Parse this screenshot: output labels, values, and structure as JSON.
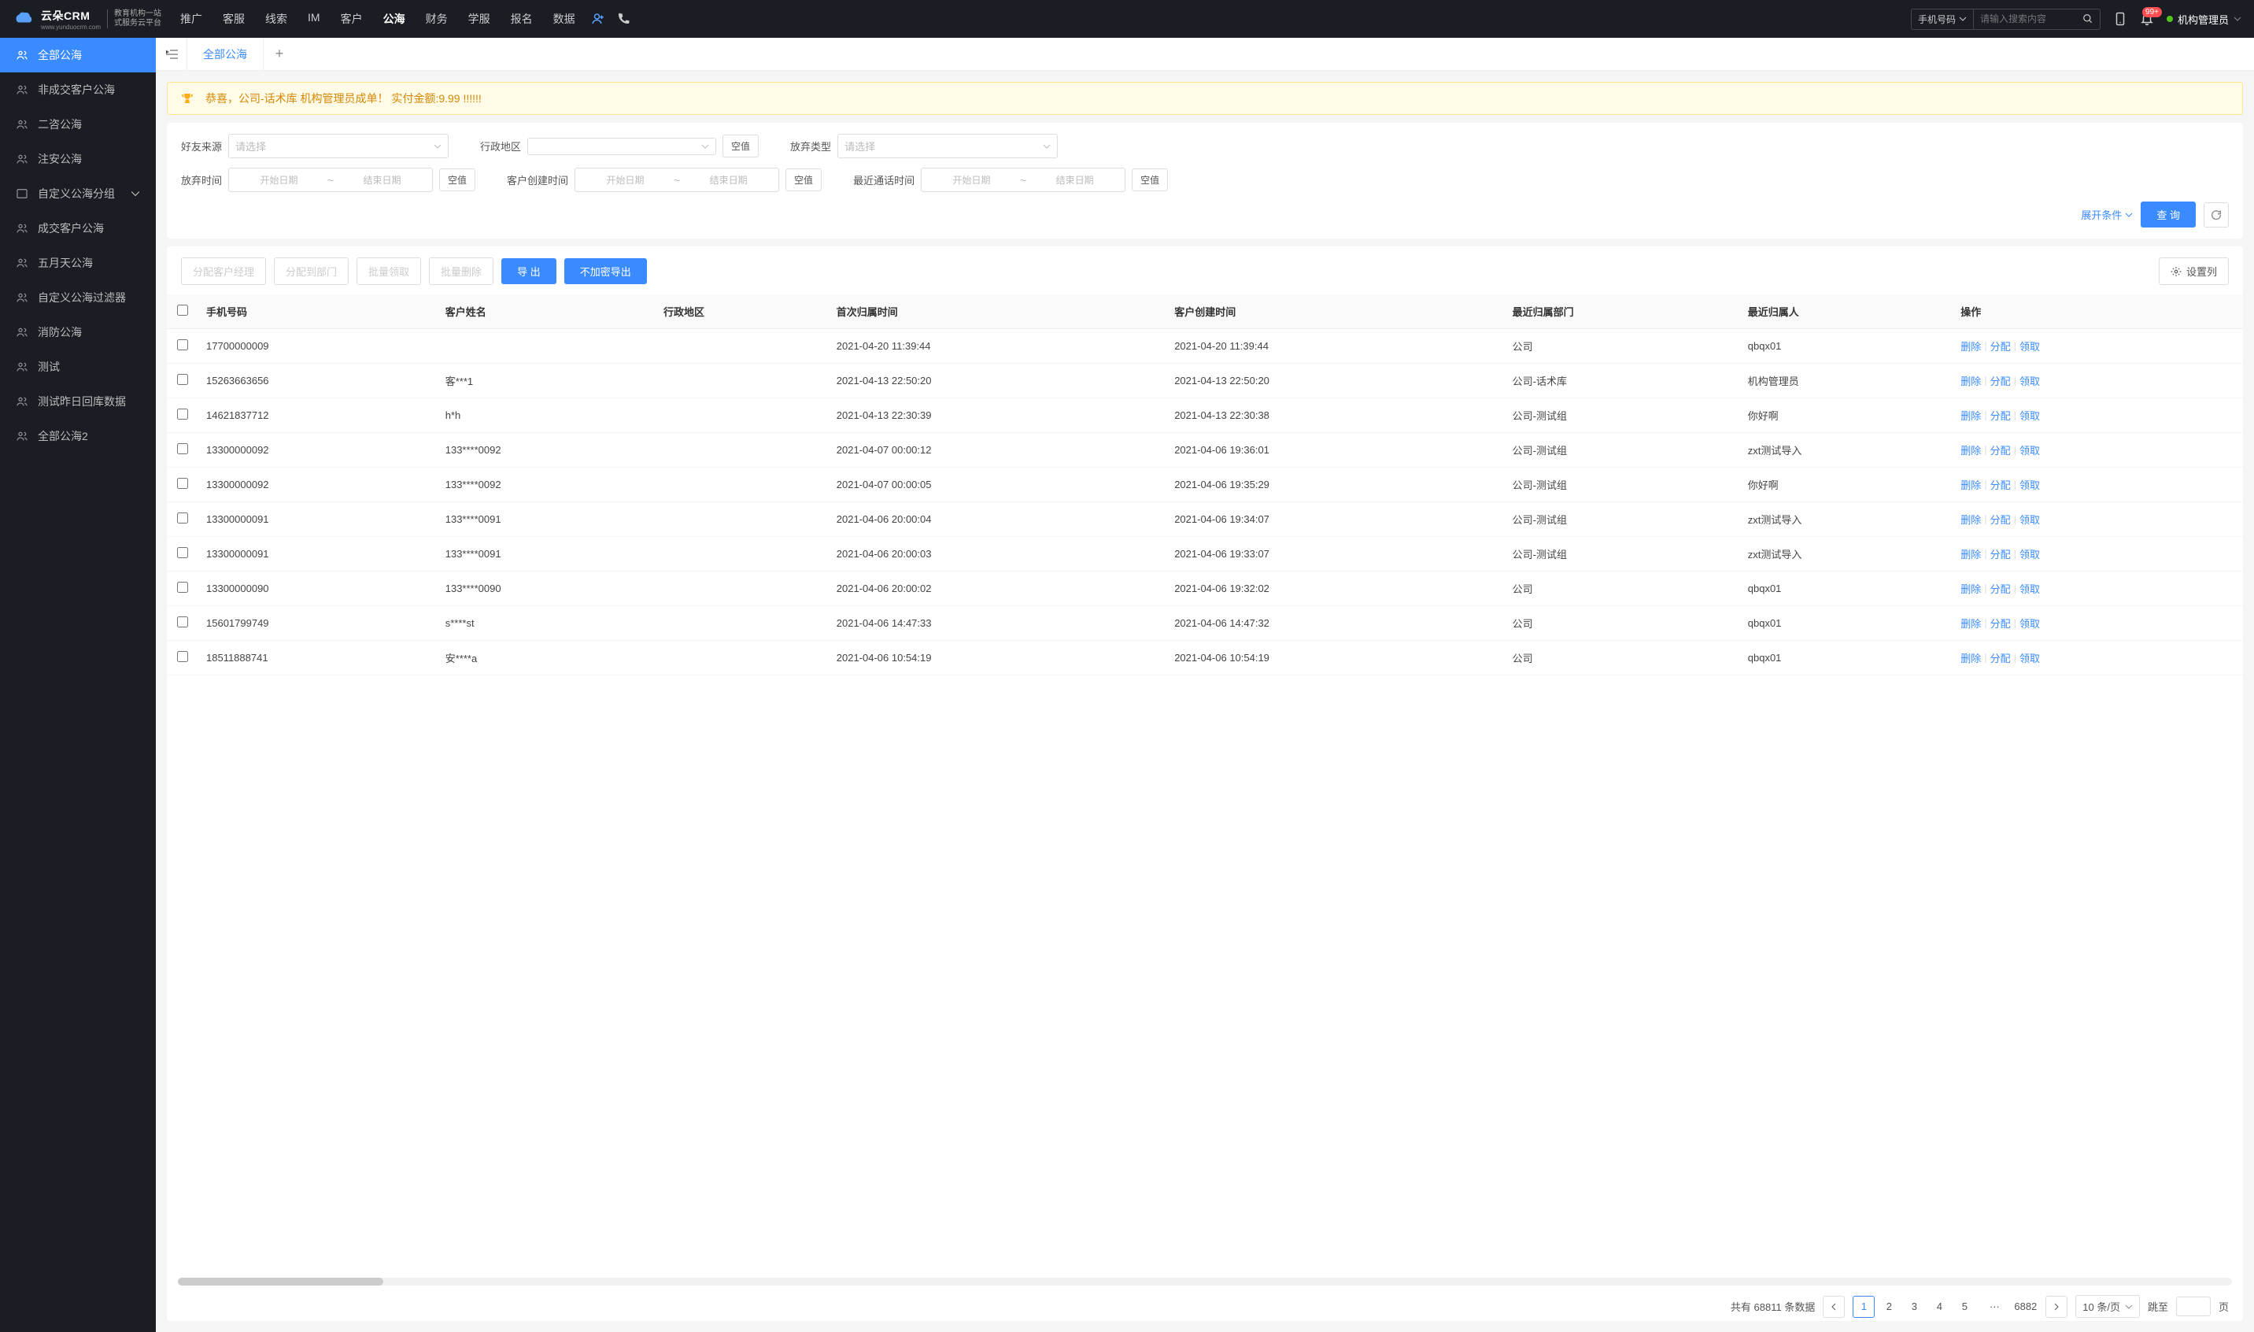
{
  "logo": {
    "brand": "云朵CRM",
    "url": "www.yunduocrm.com",
    "sub1": "教育机构一站",
    "sub2": "式服务云平台"
  },
  "nav": {
    "items": [
      "推广",
      "客服",
      "线索",
      "IM",
      "客户",
      "公海",
      "财务",
      "学服",
      "报名",
      "数据"
    ],
    "active": 5
  },
  "search": {
    "type": "手机号码",
    "placeholder": "请输入搜索内容"
  },
  "notif_badge": "99+",
  "user": {
    "name": "机构管理员"
  },
  "sidebar": {
    "items": [
      {
        "label": "全部公海",
        "icon": "users",
        "active": true
      },
      {
        "label": "非成交客户公海",
        "icon": "users"
      },
      {
        "label": "二咨公海",
        "icon": "users"
      },
      {
        "label": "注安公海",
        "icon": "users"
      },
      {
        "label": "自定义公海分组",
        "icon": "folder",
        "expandable": true
      },
      {
        "label": "成交客户公海",
        "icon": "users"
      },
      {
        "label": "五月天公海",
        "icon": "users"
      },
      {
        "label": "自定义公海过滤器",
        "icon": "users"
      },
      {
        "label": "消防公海",
        "icon": "users"
      },
      {
        "label": "测试",
        "icon": "users"
      },
      {
        "label": "测试昨日回库数据",
        "icon": "users"
      },
      {
        "label": "全部公海2",
        "icon": "users"
      }
    ]
  },
  "tabs": {
    "items": [
      "全部公海"
    ]
  },
  "banner": "恭喜，公司-话术库  机构管理员成单！  实付金额:9.99 !!!!!!",
  "filters": {
    "friend_source": {
      "label": "好友来源",
      "placeholder": "请选择"
    },
    "region": {
      "label": "行政地区",
      "null_btn": "空值"
    },
    "abandon_type": {
      "label": "放弃类型",
      "placeholder": "请选择"
    },
    "abandon_time": {
      "label": "放弃时间",
      "start_ph": "开始日期",
      "end_ph": "结束日期",
      "null_btn": "空值"
    },
    "create_time": {
      "label": "客户创建时间",
      "start_ph": "开始日期",
      "end_ph": "结束日期",
      "null_btn": "空值"
    },
    "call_time": {
      "label": "最近通话时间",
      "start_ph": "开始日期",
      "end_ph": "结束日期",
      "null_btn": "空值"
    },
    "expand": "展开条件",
    "query": "查 询"
  },
  "toolbar": {
    "assign_mgr": "分配客户经理",
    "assign_dept": "分配到部门",
    "batch_claim": "批量领取",
    "batch_delete": "批量删除",
    "export": "导 出",
    "export_plain": "不加密导出",
    "set_cols": "设置列"
  },
  "table": {
    "headers": [
      "手机号码",
      "客户姓名",
      "行政地区",
      "首次归属时间",
      "客户创建时间",
      "最近归属部门",
      "最近归属人",
      "操作"
    ],
    "ops": {
      "delete": "删除",
      "assign": "分配",
      "claim": "领取"
    },
    "rows": [
      {
        "phone": "17700000009",
        "name": "",
        "region": "",
        "first_time": "2021-04-20 11:39:44",
        "create_time": "2021-04-20 11:39:44",
        "dept": "公司",
        "owner": "qbqx01"
      },
      {
        "phone": "15263663656",
        "name": "客***1",
        "region": "",
        "first_time": "2021-04-13 22:50:20",
        "create_time": "2021-04-13 22:50:20",
        "dept": "公司-话术库",
        "owner": "机构管理员"
      },
      {
        "phone": "14621837712",
        "name": "h*h",
        "region": "",
        "first_time": "2021-04-13 22:30:39",
        "create_time": "2021-04-13 22:30:38",
        "dept": "公司-测试组",
        "owner": "你好啊"
      },
      {
        "phone": "13300000092",
        "name": "133****0092",
        "region": "",
        "first_time": "2021-04-07 00:00:12",
        "create_time": "2021-04-06 19:36:01",
        "dept": "公司-测试组",
        "owner": "zxt测试导入"
      },
      {
        "phone": "13300000092",
        "name": "133****0092",
        "region": "",
        "first_time": "2021-04-07 00:00:05",
        "create_time": "2021-04-06 19:35:29",
        "dept": "公司-测试组",
        "owner": "你好啊"
      },
      {
        "phone": "13300000091",
        "name": "133****0091",
        "region": "",
        "first_time": "2021-04-06 20:00:04",
        "create_time": "2021-04-06 19:34:07",
        "dept": "公司-测试组",
        "owner": "zxt测试导入"
      },
      {
        "phone": "13300000091",
        "name": "133****0091",
        "region": "",
        "first_time": "2021-04-06 20:00:03",
        "create_time": "2021-04-06 19:33:07",
        "dept": "公司-测试组",
        "owner": "zxt测试导入"
      },
      {
        "phone": "13300000090",
        "name": "133****0090",
        "region": "",
        "first_time": "2021-04-06 20:00:02",
        "create_time": "2021-04-06 19:32:02",
        "dept": "公司",
        "owner": "qbqx01"
      },
      {
        "phone": "15601799749",
        "name": "s****st",
        "region": "",
        "first_time": "2021-04-06 14:47:33",
        "create_time": "2021-04-06 14:47:32",
        "dept": "公司",
        "owner": "qbqx01"
      },
      {
        "phone": "18511888741",
        "name": "安****a",
        "region": "",
        "first_time": "2021-04-06 10:54:19",
        "create_time": "2021-04-06 10:54:19",
        "dept": "公司",
        "owner": "qbqx01"
      }
    ]
  },
  "pagination": {
    "total_prefix": "共有",
    "total": "68811",
    "total_suffix": "条数据",
    "pages": [
      "1",
      "2",
      "3",
      "4",
      "5"
    ],
    "ellipsis": "···",
    "last_page": "6882",
    "size_label": "10 条/页",
    "jump_label": "跳至",
    "jump_suffix": "页"
  }
}
